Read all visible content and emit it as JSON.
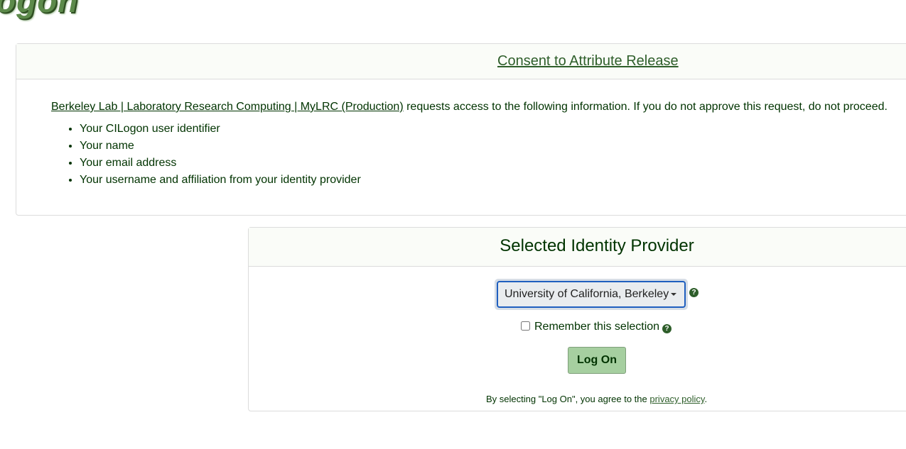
{
  "logo": {
    "text": "ogon"
  },
  "consent": {
    "title": "Consent to Attribute Release",
    "client_link": "Berkeley Lab | Laboratory Research Computing | MyLRC (Production)",
    "intro_rest": " requests access to the following information. If you do not approve this request, do not proceed.",
    "attributes": [
      "Your CILogon user identifier",
      "Your name",
      "Your email address",
      "Your username and affiliation from your identity provider"
    ]
  },
  "idp": {
    "title": "Selected Identity Provider",
    "selected": "University of California, Berkeley",
    "help_glyph": "?",
    "remember_label": "Remember this selection",
    "remember_checked": false,
    "logon_label": "Log On",
    "agree_prefix": "By selecting \"Log On\", you agree to the ",
    "privacy_link": "privacy policy",
    "agree_suffix": "."
  },
  "colors": {
    "text": "#003300",
    "link_green": "#2e5e2a",
    "button_bg": "#a6cfa0",
    "select_border": "#1f5fbf"
  },
  "icons": [
    "question-circle-icon",
    "chevron-down-icon"
  ]
}
